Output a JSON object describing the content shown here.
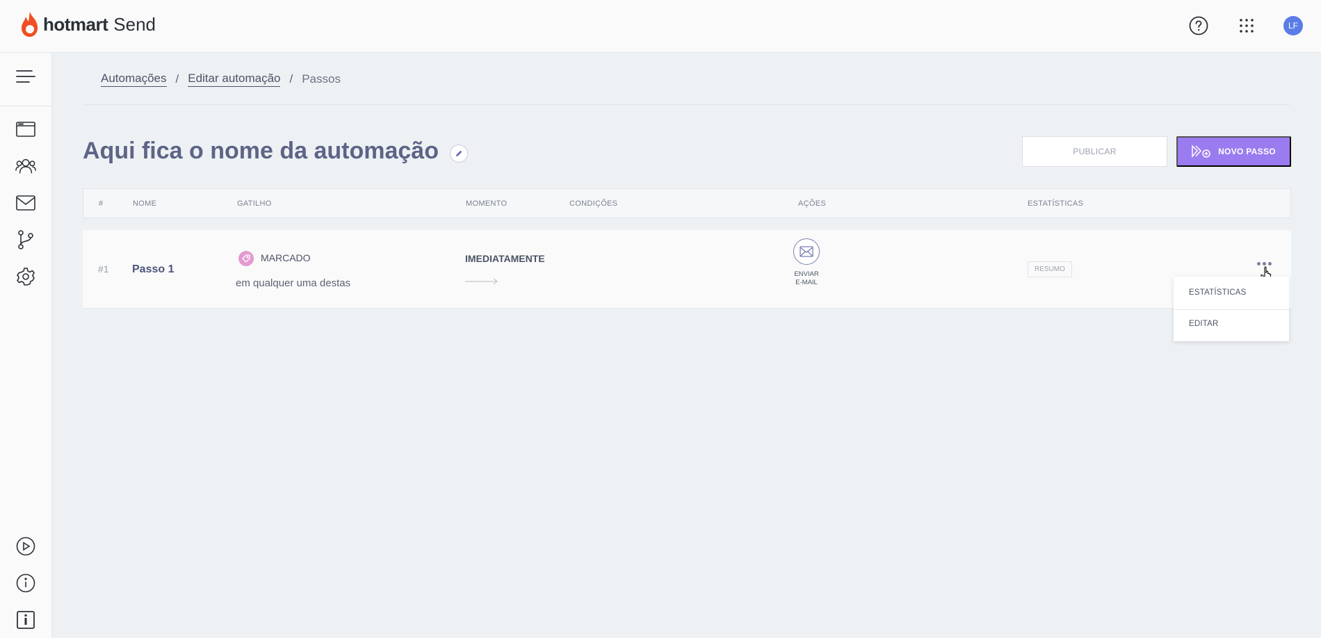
{
  "app": {
    "brand": "hotmart",
    "brand_suffix": "Send",
    "avatar_initials": "LF"
  },
  "breadcrumb": {
    "items": [
      "Automações",
      "Editar automação"
    ],
    "separator": "/",
    "current": "Passos"
  },
  "page": {
    "title": "Aqui fica o nome da automação"
  },
  "buttons": {
    "publish": "PUBLICAR",
    "new_step": "NOVO PASSO"
  },
  "table": {
    "columns": [
      "#",
      "NOME",
      "GATILHO",
      "MOMENTO",
      "CONDIÇÕES",
      "AÇÕES",
      "ESTATÍSTICAS"
    ],
    "rows": [
      {
        "number": "#1",
        "name": "Passo 1",
        "trigger_tag": "MARCADO",
        "trigger_desc": "em qualquer uma destas",
        "moment": "IMEDIATAMENTE",
        "action_label_line1": "ENVIAR",
        "action_label_line2": "E-MAIL",
        "stats_badge": "RESUMO"
      }
    ]
  },
  "context_menu": {
    "items": [
      "ESTATÍSTICAS",
      "EDITAR"
    ]
  },
  "colors": {
    "accent": "#9b7bf0",
    "title": "#5d6486",
    "avatar": "#5b7ce6",
    "tag": "#e39ad0",
    "logo_flame": "#f04e23"
  },
  "icons": {
    "top": [
      "help-icon",
      "apps-grid-icon"
    ],
    "sidebar": [
      "menu-icon",
      "browser-icon",
      "contacts-icon",
      "email-icon",
      "flow-icon",
      "settings-icon",
      "play-icon",
      "info-icon",
      "info-box-icon"
    ]
  }
}
